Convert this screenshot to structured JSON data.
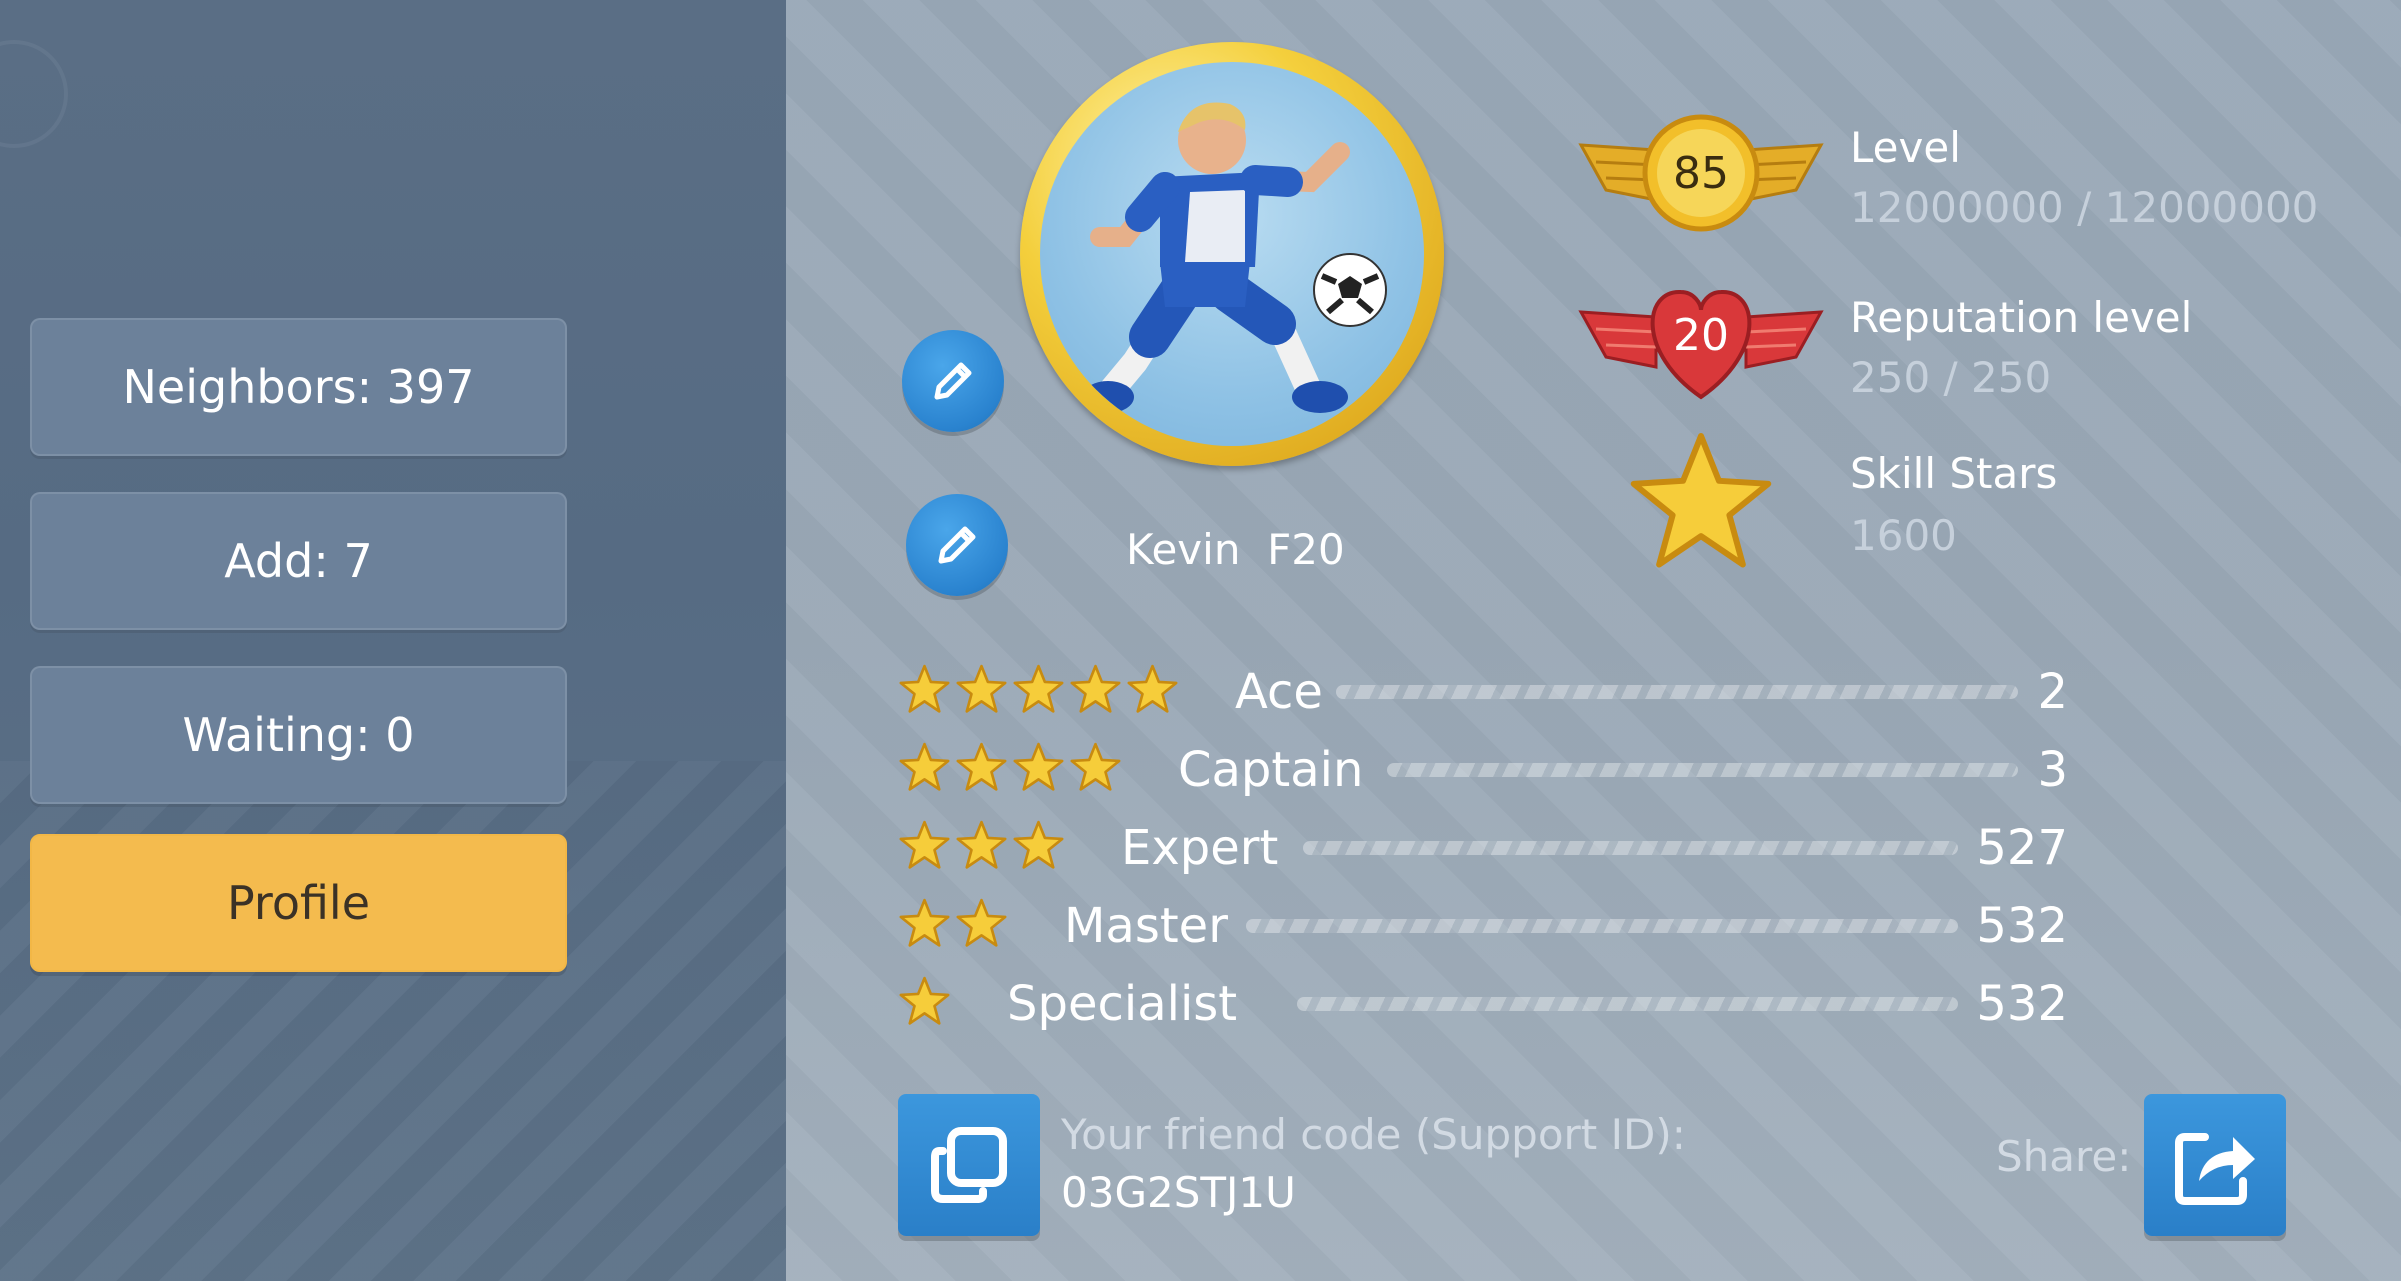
{
  "sidebar": {
    "items": [
      {
        "label": "Neighbors: 397"
      },
      {
        "label": "Add: 7"
      },
      {
        "label": "Waiting: 0"
      },
      {
        "label": "Profile",
        "active": true
      }
    ]
  },
  "profile": {
    "name": "Kevin  F20",
    "level": {
      "badge": "85",
      "label": "Level",
      "value": "12000000 / 12000000"
    },
    "reputation": {
      "badge": "20",
      "label": "Reputation level",
      "value": "250 / 250"
    },
    "skill_stars": {
      "label": "Skill Stars",
      "value": "1600"
    }
  },
  "rankings": [
    {
      "stars": 5,
      "name": "Ace",
      "count": "2"
    },
    {
      "stars": 4,
      "name": "Captain",
      "count": "3"
    },
    {
      "stars": 3,
      "name": "Expert",
      "count": "527"
    },
    {
      "stars": 2,
      "name": "Master",
      "count": "532"
    },
    {
      "stars": 1,
      "name": "Specialist",
      "count": "532"
    }
  ],
  "friend": {
    "label": "Your friend code (Support ID):",
    "code": "03G2STJ1U",
    "share_label": "Share:"
  },
  "icons": {
    "edit": "pencil-icon",
    "copy": "copy-icon",
    "share": "share-icon",
    "star": "star-icon",
    "level": "winged-level-badge",
    "reputation": "winged-heart-badge"
  },
  "colors": {
    "active_tab": "#f4bb4e",
    "button_blue": "#2a83cf",
    "gold": "#f4cf3c",
    "reputation_red": "#d9383a"
  }
}
